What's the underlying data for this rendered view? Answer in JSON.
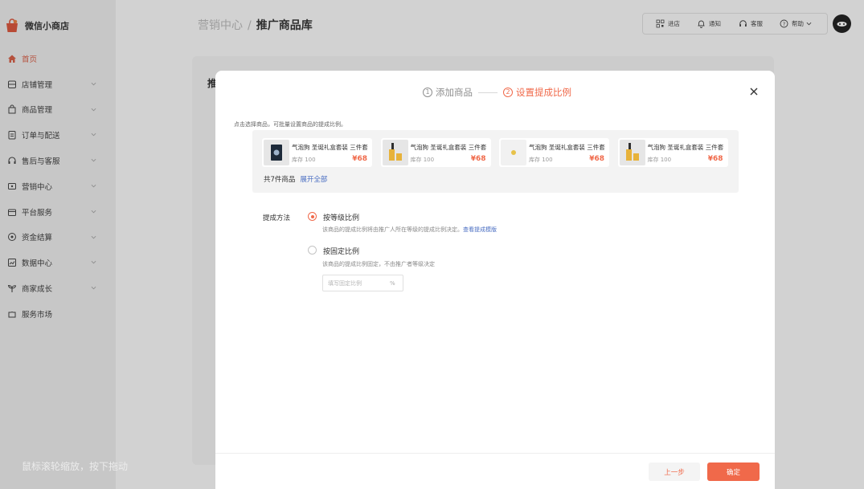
{
  "app": {
    "name": "微信小商店"
  },
  "sidebar": {
    "items": [
      {
        "label": "首页",
        "icon": "home-icon",
        "active": true
      },
      {
        "label": "店铺管理",
        "icon": "store-icon"
      },
      {
        "label": "商品管理",
        "icon": "bag-icon"
      },
      {
        "label": "订单与配送",
        "icon": "order-icon"
      },
      {
        "label": "售后与客服",
        "icon": "headset-icon"
      },
      {
        "label": "营销中心",
        "icon": "coupon-icon"
      },
      {
        "label": "平台服务",
        "icon": "service-icon"
      },
      {
        "label": "资金结算",
        "icon": "coin-icon"
      },
      {
        "label": "数据中心",
        "icon": "chart-icon"
      },
      {
        "label": "商家成长",
        "icon": "sprout-icon"
      },
      {
        "label": "服务市场",
        "icon": "puzzle-icon"
      }
    ]
  },
  "header": {
    "breadcrumb": {
      "parent": "营销中心",
      "separator": "/",
      "current": "推广商品库"
    },
    "tools": [
      {
        "label": "进店",
        "icon": "qrcode-icon"
      },
      {
        "label": "通知",
        "icon": "bell-icon"
      },
      {
        "label": "客服",
        "icon": "headset-icon"
      },
      {
        "label": "帮助",
        "icon": "help-icon"
      }
    ]
  },
  "background_panel": {
    "title": "推"
  },
  "hint_text": "鼠标滚轮缩放，按下拖动",
  "modal": {
    "steps": [
      {
        "num": "1",
        "label": "添加商品",
        "state": "done"
      },
      {
        "num": "2",
        "label": "设置提成比例",
        "state": "active"
      }
    ],
    "instruction": "点击选择商品，可批量设置商品的提成比例。",
    "goods": [
      {
        "name": "气泡狗 圣诞礼盒套装 三件套",
        "stock": "库存 100",
        "price": "¥68"
      },
      {
        "name": "气泡狗 圣诞礼盒套装 三件套",
        "stock": "库存 100",
        "price": "¥68"
      },
      {
        "name": "气泡狗 圣诞礼盒套装 三件套",
        "stock": "库存 100",
        "price": "¥68"
      },
      {
        "name": "气泡狗 圣诞礼盒套装 三件套",
        "stock": "库存 100",
        "price": "¥68"
      }
    ],
    "goods_count": "共7件商品",
    "expand_label": "展开全部",
    "method_label": "提成方法",
    "option_level": {
      "label": "按等级比例",
      "desc": "该商品的提成比例将由推广人所在等级的提成比例决定。",
      "link": "查看提成模版",
      "checked": true
    },
    "option_fixed": {
      "label": "按固定比例",
      "desc": "该商品的提成比例固定，不由推广者等级决定",
      "checked": false
    },
    "percent_input": {
      "placeholder": "填写固定比例",
      "unit": "%",
      "value": ""
    },
    "footer": {
      "prev_label": "上一步",
      "confirm_label": "确定"
    }
  },
  "colors": {
    "accent": "#f0694a",
    "link": "#4a6ec2",
    "sidebar_bg": "#c7c7c7",
    "overlay_bg": "#d2d2d2"
  }
}
